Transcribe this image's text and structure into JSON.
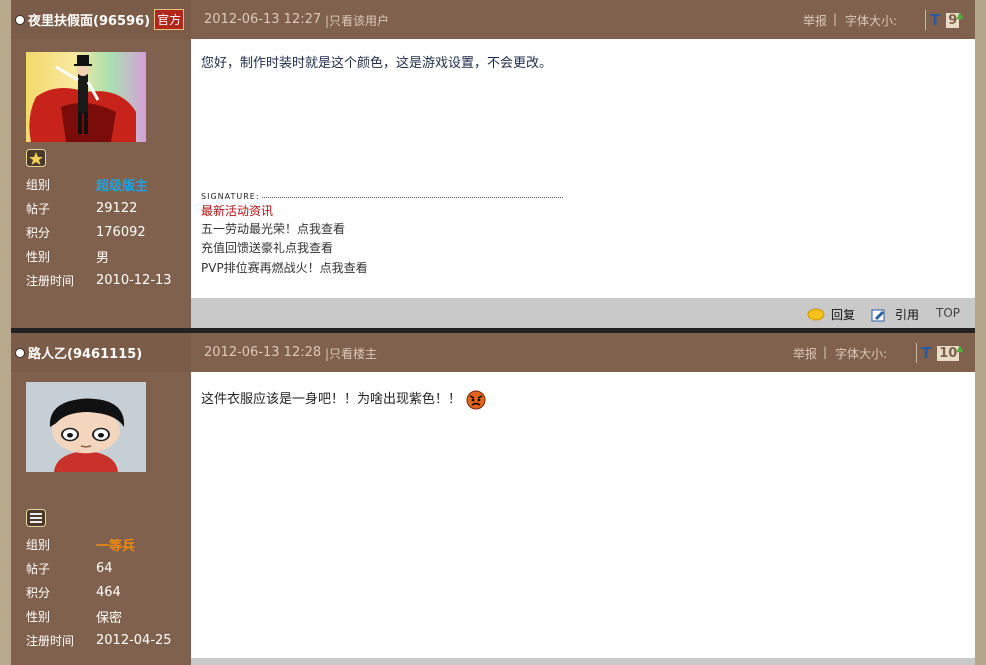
{
  "post1": {
    "username": "夜里扶假面(96596)",
    "badge": "官方",
    "date": "2012-06-13 12:27",
    "view_only": "|只看该用户",
    "report": "举报",
    "sep": "|",
    "font_size_label": "字体大小:",
    "font_t": "T",
    "font_num": "9",
    "info": [
      {
        "label": "组别",
        "value": "超级版主"
      },
      {
        "label": "帖子",
        "value": "29122"
      },
      {
        "label": "积分",
        "value": "176092"
      },
      {
        "label": "性别",
        "value": "男"
      },
      {
        "label": "注册时间",
        "value": "2010-12-13"
      }
    ],
    "message": "您好，制作时装时就是这个颜色，这是游戏设置，不会更改。",
    "signature_label": "SIGNATURE:",
    "sig_title": "最新活动资讯",
    "sig_items": [
      "五一劳动最光荣！点我查看",
      "充值回馈送豪礼点我查看",
      "PVP排位赛再燃战火！点我查看"
    ],
    "reply": "回复",
    "quote": "引用",
    "top": "TOP"
  },
  "post2": {
    "username": "路人乙(9461115)",
    "date": "2012-06-13 12:28",
    "view_only": "|只看楼主",
    "report": "举报",
    "sep": "|",
    "font_size_label": "字体大小:",
    "font_t": "T",
    "font_num": "10",
    "info": [
      {
        "label": "组别",
        "value": "一等兵"
      },
      {
        "label": "帖子",
        "value": "64"
      },
      {
        "label": "积分",
        "value": "464"
      },
      {
        "label": "性别",
        "value": "保密"
      },
      {
        "label": "注册时间",
        "value": "2012-04-25"
      }
    ],
    "message": "这件衣服应该是一身吧！！为啥出现紫色！！"
  },
  "colors": {
    "sidebar": "#7f614d",
    "footer": "#c9c9c9",
    "group_blue": "#1ea2e0",
    "group_orange": "#f08a12",
    "sig_red": "#b01010"
  }
}
